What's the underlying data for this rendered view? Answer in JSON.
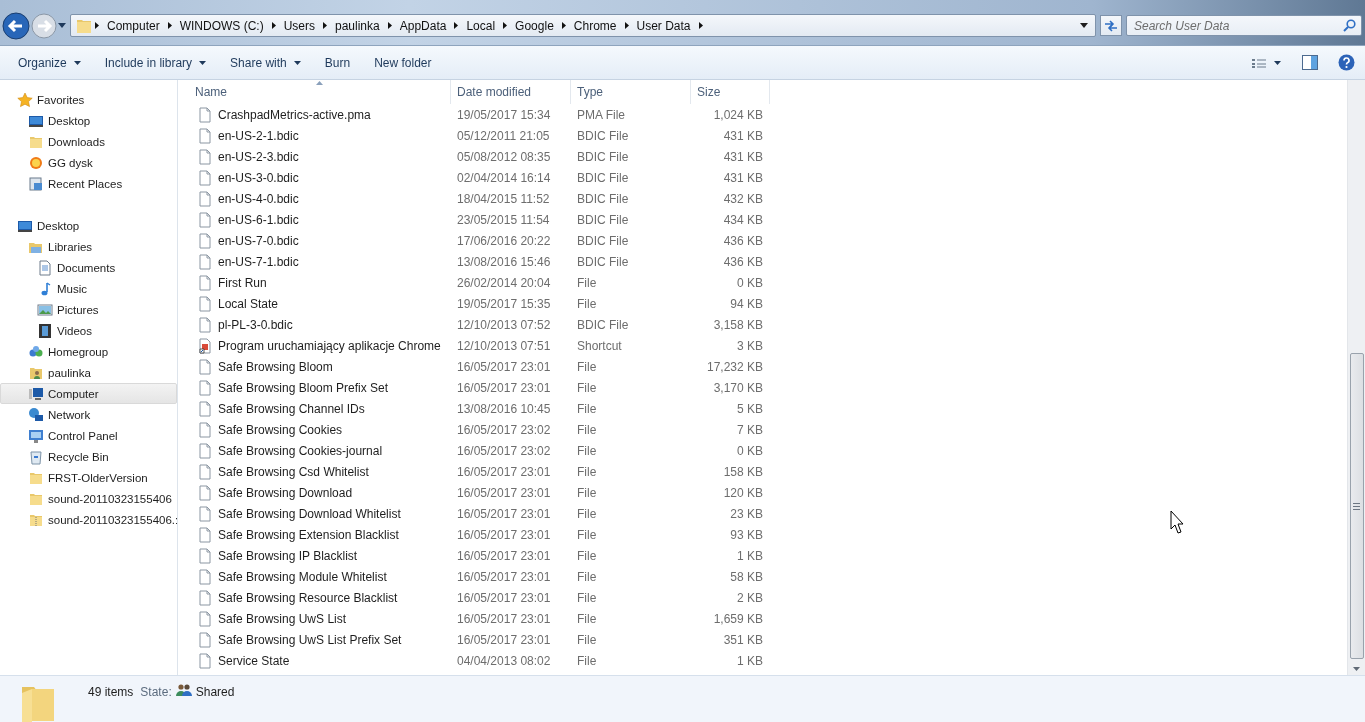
{
  "address_bar": {
    "breadcrumbs": [
      "Computer",
      "WINDOWS (C:)",
      "Users",
      "paulinka",
      "AppData",
      "Local",
      "Google",
      "Chrome",
      "User Data"
    ],
    "search": {
      "placeholder": "Search User Data"
    }
  },
  "toolbar": {
    "buttons": [
      {
        "label": "Organize",
        "dropdown": true
      },
      {
        "label": "Include in library",
        "dropdown": true
      },
      {
        "label": "Share with",
        "dropdown": true
      },
      {
        "label": "Burn",
        "dropdown": false
      },
      {
        "label": "New folder",
        "dropdown": false
      }
    ]
  },
  "navigation_pane": {
    "items": [
      {
        "label": "Favorites",
        "kind": "star",
        "selected": false,
        "children": [
          {
            "label": "Desktop",
            "kind": "desktop",
            "selected": false
          },
          {
            "label": "Downloads",
            "kind": "folder",
            "selected": false
          },
          {
            "label": "GG dysk",
            "kind": "sun",
            "selected": false
          },
          {
            "label": "Recent Places",
            "kind": "recent",
            "selected": false
          }
        ]
      },
      {
        "label": "Desktop",
        "kind": "desktop",
        "selected": false,
        "children": [
          {
            "label": "Libraries",
            "kind": "library",
            "selected": false,
            "children": [
              {
                "label": "Documents",
                "kind": "document",
                "selected": false
              },
              {
                "label": "Music",
                "kind": "music",
                "selected": false
              },
              {
                "label": "Pictures",
                "kind": "picture",
                "selected": false
              },
              {
                "label": "Videos",
                "kind": "video",
                "selected": false
              }
            ]
          },
          {
            "label": "Homegroup",
            "kind": "homegroup",
            "selected": false
          },
          {
            "label": "paulinka",
            "kind": "user",
            "selected": false
          },
          {
            "label": "Computer",
            "kind": "computer",
            "selected": true
          },
          {
            "label": "Network",
            "kind": "network",
            "selected": false
          },
          {
            "label": "Control Panel",
            "kind": "control",
            "selected": false
          },
          {
            "label": "Recycle Bin",
            "kind": "recycle",
            "selected": false
          },
          {
            "label": "FRST-OlderVersion",
            "kind": "folder",
            "selected": false
          },
          {
            "label": "sound-20110323155406",
            "kind": "folder",
            "selected": false
          },
          {
            "label": "sound-20110323155406.:",
            "kind": "zip",
            "selected": false
          }
        ]
      }
    ]
  },
  "file_list": {
    "columns": [
      "Name",
      "Date modified",
      "Type",
      "Size"
    ],
    "rows": [
      {
        "name": "CrashpadMetrics-active.pma",
        "date": "19/05/2017 15:34",
        "type": "PMA File",
        "size": "1,024 KB",
        "kind": "file"
      },
      {
        "name": "en-US-2-1.bdic",
        "date": "05/12/2011 21:05",
        "type": "BDIC File",
        "size": "431 KB",
        "kind": "file"
      },
      {
        "name": "en-US-2-3.bdic",
        "date": "05/08/2012 08:35",
        "type": "BDIC File",
        "size": "431 KB",
        "kind": "file"
      },
      {
        "name": "en-US-3-0.bdic",
        "date": "02/04/2014 16:14",
        "type": "BDIC File",
        "size": "431 KB",
        "kind": "file"
      },
      {
        "name": "en-US-4-0.bdic",
        "date": "18/04/2015 11:52",
        "type": "BDIC File",
        "size": "432 KB",
        "kind": "file"
      },
      {
        "name": "en-US-6-1.bdic",
        "date": "23/05/2015 11:54",
        "type": "BDIC File",
        "size": "434 KB",
        "kind": "file"
      },
      {
        "name": "en-US-7-0.bdic",
        "date": "17/06/2016 20:22",
        "type": "BDIC File",
        "size": "436 KB",
        "kind": "file"
      },
      {
        "name": "en-US-7-1.bdic",
        "date": "13/08/2016 15:46",
        "type": "BDIC File",
        "size": "436 KB",
        "kind": "file"
      },
      {
        "name": "First Run",
        "date": "26/02/2014 20:04",
        "type": "File",
        "size": "0 KB",
        "kind": "file"
      },
      {
        "name": "Local State",
        "date": "19/05/2017 15:35",
        "type": "File",
        "size": "94 KB",
        "kind": "file"
      },
      {
        "name": "pl-PL-3-0.bdic",
        "date": "12/10/2013 07:52",
        "type": "BDIC File",
        "size": "3,158 KB",
        "kind": "file"
      },
      {
        "name": "Program uruchamiający aplikacje Chrome",
        "date": "12/10/2013 07:51",
        "type": "Shortcut",
        "size": "3 KB",
        "kind": "shortcut"
      },
      {
        "name": "Safe Browsing Bloom",
        "date": "16/05/2017 23:01",
        "type": "File",
        "size": "17,232 KB",
        "kind": "file"
      },
      {
        "name": "Safe Browsing Bloom Prefix Set",
        "date": "16/05/2017 23:01",
        "type": "File",
        "size": "3,170 KB",
        "kind": "file"
      },
      {
        "name": "Safe Browsing Channel IDs",
        "date": "13/08/2016 10:45",
        "type": "File",
        "size": "5 KB",
        "kind": "file"
      },
      {
        "name": "Safe Browsing Cookies",
        "date": "16/05/2017 23:02",
        "type": "File",
        "size": "7 KB",
        "kind": "file"
      },
      {
        "name": "Safe Browsing Cookies-journal",
        "date": "16/05/2017 23:02",
        "type": "File",
        "size": "0 KB",
        "kind": "file"
      },
      {
        "name": "Safe Browsing Csd Whitelist",
        "date": "16/05/2017 23:01",
        "type": "File",
        "size": "158 KB",
        "kind": "file"
      },
      {
        "name": "Safe Browsing Download",
        "date": "16/05/2017 23:01",
        "type": "File",
        "size": "120 KB",
        "kind": "file"
      },
      {
        "name": "Safe Browsing Download Whitelist",
        "date": "16/05/2017 23:01",
        "type": "File",
        "size": "23 KB",
        "kind": "file"
      },
      {
        "name": "Safe Browsing Extension Blacklist",
        "date": "16/05/2017 23:01",
        "type": "File",
        "size": "93 KB",
        "kind": "file"
      },
      {
        "name": "Safe Browsing IP Blacklist",
        "date": "16/05/2017 23:01",
        "type": "File",
        "size": "1 KB",
        "kind": "file"
      },
      {
        "name": "Safe Browsing Module Whitelist",
        "date": "16/05/2017 23:01",
        "type": "File",
        "size": "58 KB",
        "kind": "file"
      },
      {
        "name": "Safe Browsing Resource Blacklist",
        "date": "16/05/2017 23:01",
        "type": "File",
        "size": "2 KB",
        "kind": "file"
      },
      {
        "name": "Safe Browsing UwS List",
        "date": "16/05/2017 23:01",
        "type": "File",
        "size": "1,659 KB",
        "kind": "file"
      },
      {
        "name": "Safe Browsing UwS List Prefix Set",
        "date": "16/05/2017 23:01",
        "type": "File",
        "size": "351 KB",
        "kind": "file"
      },
      {
        "name": "Service State",
        "date": "04/04/2013 08:02",
        "type": "File",
        "size": "1 KB",
        "kind": "file"
      }
    ]
  },
  "status_bar": {
    "item_count": "49 items",
    "state_label": "State:",
    "state_value": "Shared"
  }
}
